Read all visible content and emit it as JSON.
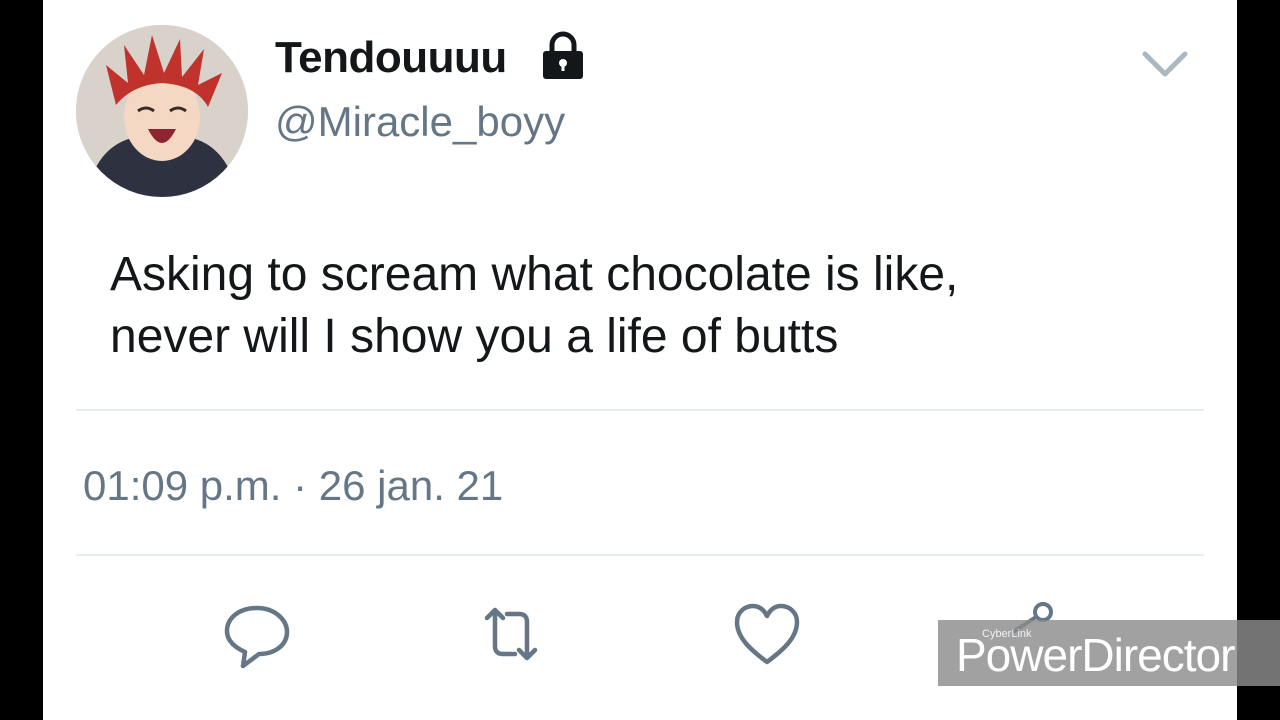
{
  "tweet": {
    "display_name": "Tendouuuu",
    "handle": "@Miracle_boyy",
    "text_line1": "Asking to scream what chocolate is like,",
    "text_line2": "never will I show you a life of butts",
    "timestamp": "01:09 p.m. · 26 jan. 21"
  },
  "icons": {
    "lock": "lock-icon",
    "menu": "chevron-down-icon",
    "reply": "reply-icon",
    "retweet": "retweet-icon",
    "like": "heart-icon",
    "share": "share-icon"
  },
  "watermark": {
    "brand_small": "CyberLink",
    "brand_main": "PowerDirector"
  },
  "colors": {
    "text_primary": "#14171a",
    "text_secondary": "#657786",
    "divider": "#e6ecf0",
    "icon": "#657786"
  }
}
